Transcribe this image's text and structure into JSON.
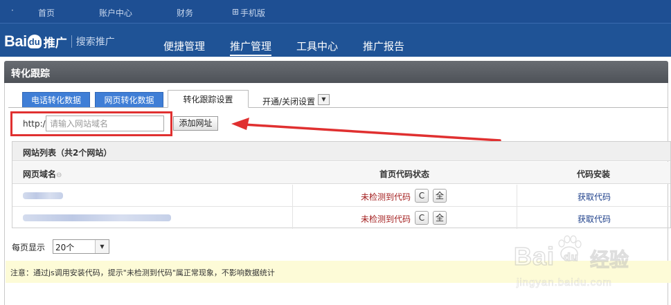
{
  "topbar": {
    "items": [
      {
        "label": "首页"
      },
      {
        "label": "账户中心"
      },
      {
        "label": "财务"
      },
      {
        "label": "手机版"
      }
    ]
  },
  "brand": {
    "bai": "Bai",
    "du": "du",
    "product": "推广",
    "sub": "搜索推广"
  },
  "mainnav": {
    "items": [
      {
        "label": "便捷管理"
      },
      {
        "label": "推广管理"
      },
      {
        "label": "工具中心"
      },
      {
        "label": "推广报告"
      }
    ],
    "active_index": 1
  },
  "panel": {
    "title": "转化跟踪"
  },
  "tabs": [
    {
      "label": "电话转化数据"
    },
    {
      "label": "网页转化数据"
    },
    {
      "label": "转化跟踪设置"
    }
  ],
  "toggle": {
    "label": "开通/关闭设置"
  },
  "url_form": {
    "prefix": "http://",
    "placeholder": "请输入网站域名",
    "add_label": "添加网址"
  },
  "site_list": {
    "title": "网站列表（共2个网站）",
    "columns": [
      "网页域名",
      "首页代码状态",
      "代码安装"
    ],
    "rows": [
      {
        "status": "未检测到代码",
        "refresh": "C",
        "all": "全",
        "action": "获取代码"
      },
      {
        "status": "未检测到代码",
        "refresh": "C",
        "all": "全",
        "action": "获取代码"
      }
    ]
  },
  "pagination": {
    "label": "每页显示",
    "value": "20个"
  },
  "notice": {
    "text": "注意：通过js调用安装代码，提示\"未检测到代码\"属正常现象，不影响数据统计"
  },
  "watermark": {
    "brand": "Bai",
    "du": "du",
    "cn": "经验",
    "url": "jingyan.baidu.com"
  },
  "colors": {
    "topbar": "#1e4f93",
    "tab_blue": "#3f7ed6",
    "highlight_red": "#e03030",
    "status_red": "#a42020",
    "link_blue": "#1d3f8a",
    "notice_bg": "#fdfbd7"
  },
  "icons": {
    "refresh": "refresh-icon",
    "dropdown": "chevron-down-icon",
    "sort": "sort-icon",
    "mobile": "mobile-icon"
  }
}
